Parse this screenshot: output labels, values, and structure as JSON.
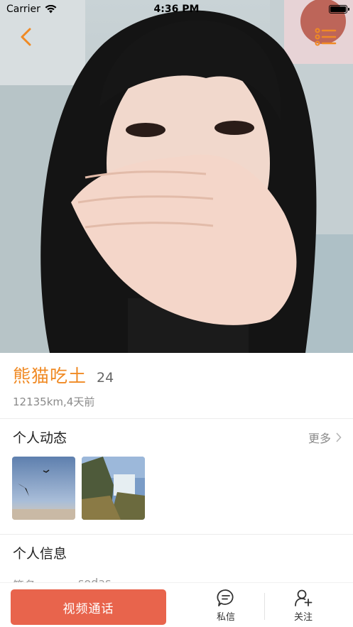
{
  "status_bar": {
    "carrier": "Carrier",
    "time": "4:36 PM"
  },
  "nav": {
    "back_icon": "chevron-left-icon",
    "menu_icon": "list-menu-icon",
    "accent_color": "#f08a24"
  },
  "profile": {
    "nickname": "熊猫吃土",
    "age": "24",
    "distance_time": "12135km,4天前"
  },
  "moments": {
    "title": "个人动态",
    "more_label": "更多",
    "thumbnails": [
      "bird-in-sky-photo",
      "waterfall-photo"
    ]
  },
  "info": {
    "title": "个人信息",
    "rows": [
      {
        "label": "签名",
        "value": "sodas"
      }
    ]
  },
  "bottom_bar": {
    "video_call_label": "视频通话",
    "message_label": "私信",
    "follow_label": "关注",
    "video_button_color": "#e8644c"
  }
}
